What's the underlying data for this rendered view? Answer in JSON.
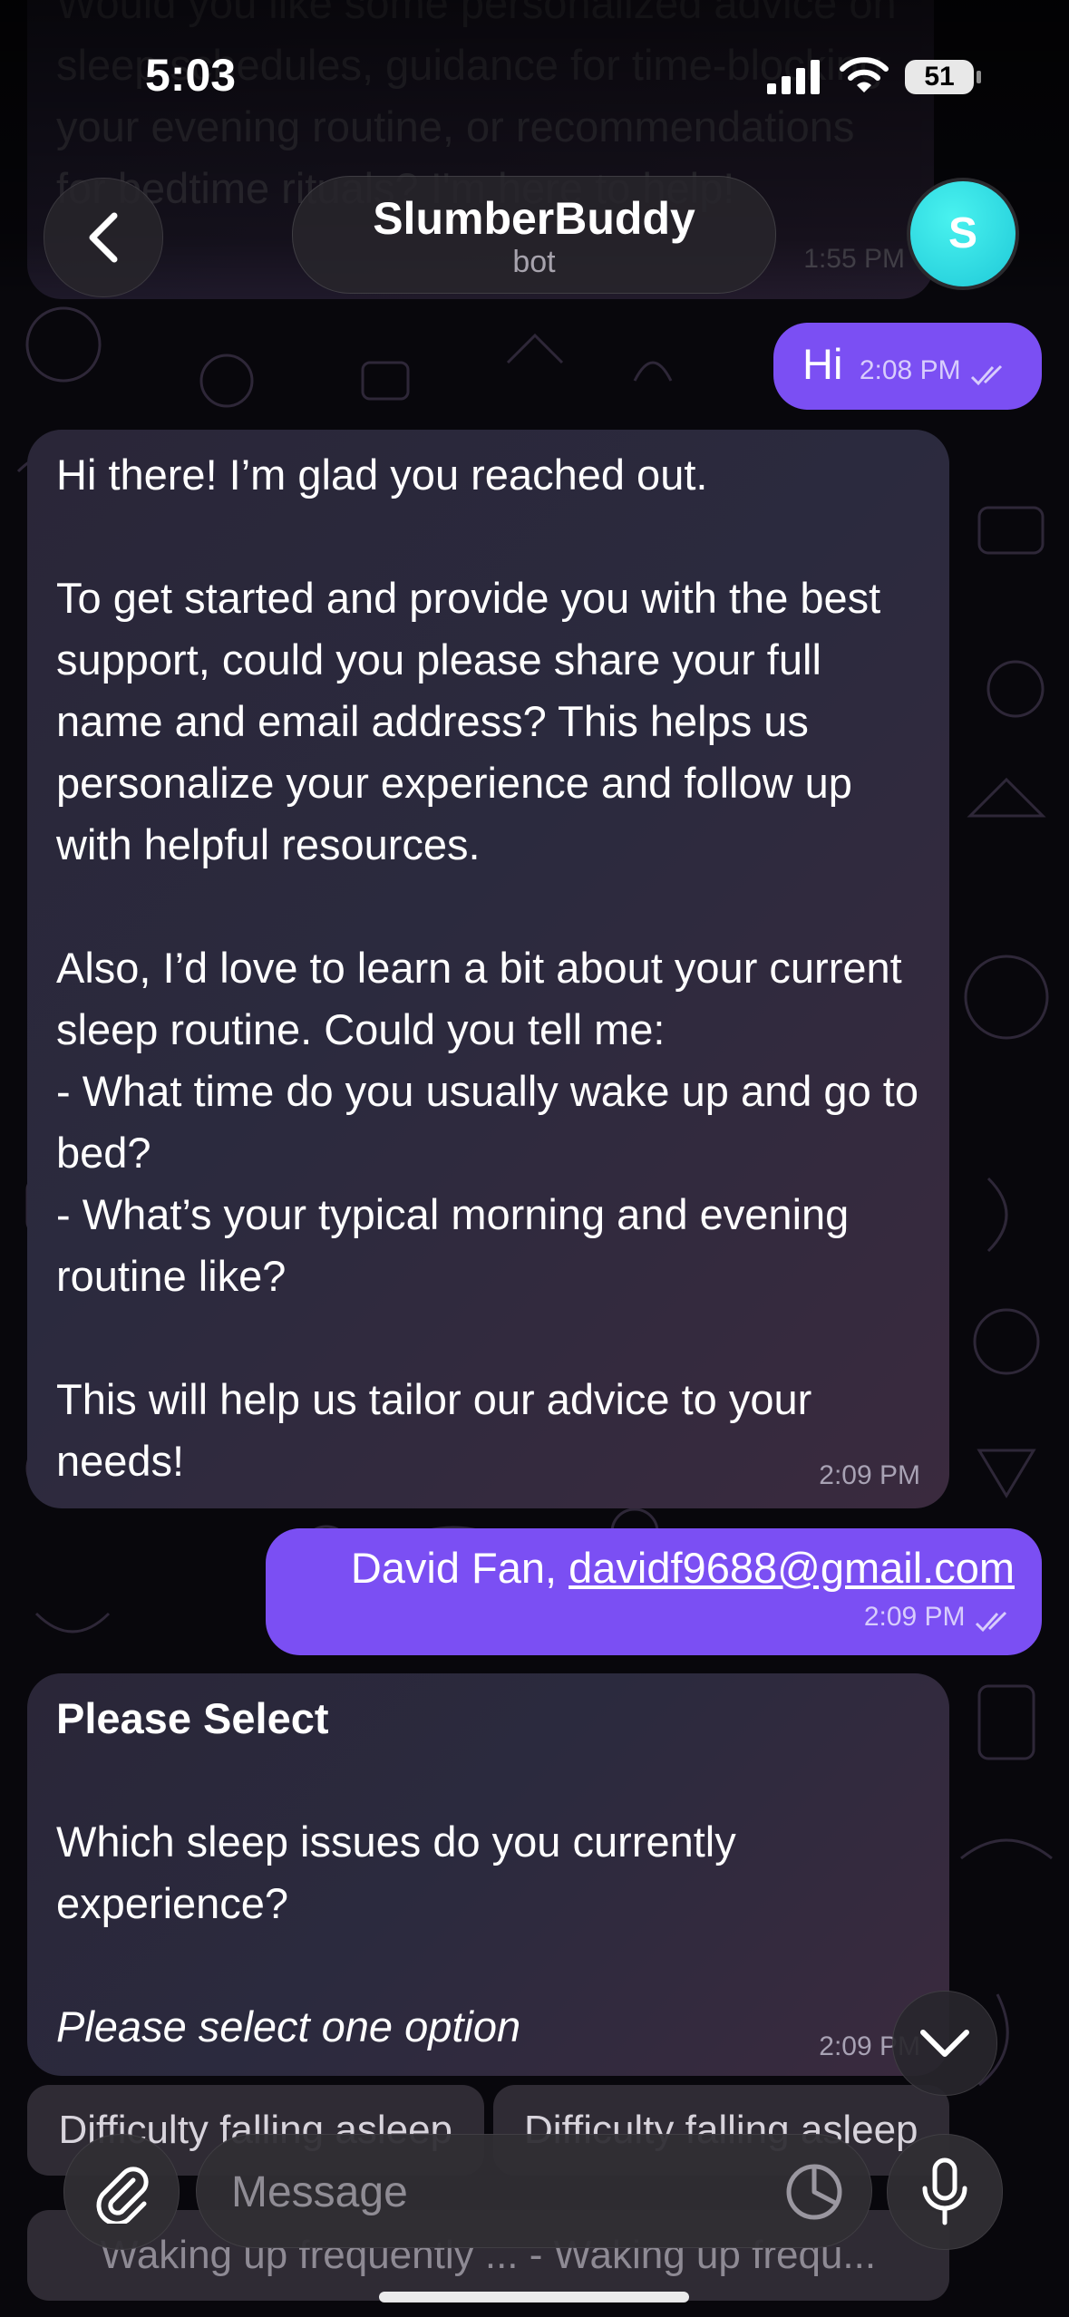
{
  "status_bar": {
    "time": "5:03",
    "battery": "51"
  },
  "header": {
    "back_icon": "chevron-left-icon",
    "title": "SlumberBuddy",
    "subtitle": "bot",
    "avatar_letter": "S",
    "avatar_color": "#2fdfe3"
  },
  "messages": {
    "previous": {
      "text": "Would you like some personalized advice on sleep schedules, guidance for time-blocking your evening routine, or recommendations for bedtime rituals? I'm here to help!",
      "time": "1:55 PM"
    },
    "user_hi": {
      "text": "Hi",
      "time": "2:08 PM"
    },
    "bot_intro": {
      "paragraphs": [
        "Hi there! I’m glad you reached out.",
        "To get started and provide you with the best support, could you please share your full name and email address? This helps us personalize your experience and follow up with helpful resources.",
        "Also, I’d love to learn a bit about your current sleep routine. Could you tell me:\n- What time do you usually wake up and go to bed?\n- What’s your typical morning and evening routine like?",
        "This will help us tailor our advice to your needs!"
      ],
      "time": "2:09 PM"
    },
    "user_contact": {
      "name_prefix": "David Fan, ",
      "email": "davidf9688@gmail.com",
      "time": "2:09 PM"
    },
    "bot_select": {
      "heading": "Please Select",
      "question": "Which sleep issues do you currently experience?",
      "hint": "Please select one option",
      "time": "2:09 PM"
    }
  },
  "reply_keyboard": {
    "row1": [
      "Difficulty falling asleep",
      "Difficulty falling asleep"
    ],
    "row2": [
      "Waking up frequently ... - Waking up frequ..."
    ]
  },
  "input_bar": {
    "placeholder": "Message",
    "attach_icon": "paperclip-icon",
    "sticker_icon": "sticker-icon",
    "mic_icon": "microphone-icon"
  },
  "scroll_down_icon": "chevron-down-icon",
  "colors": {
    "outgoing_bubble": "#7b4ff3",
    "incoming_bubble": "#2b2a3e",
    "background": "#08070c"
  }
}
